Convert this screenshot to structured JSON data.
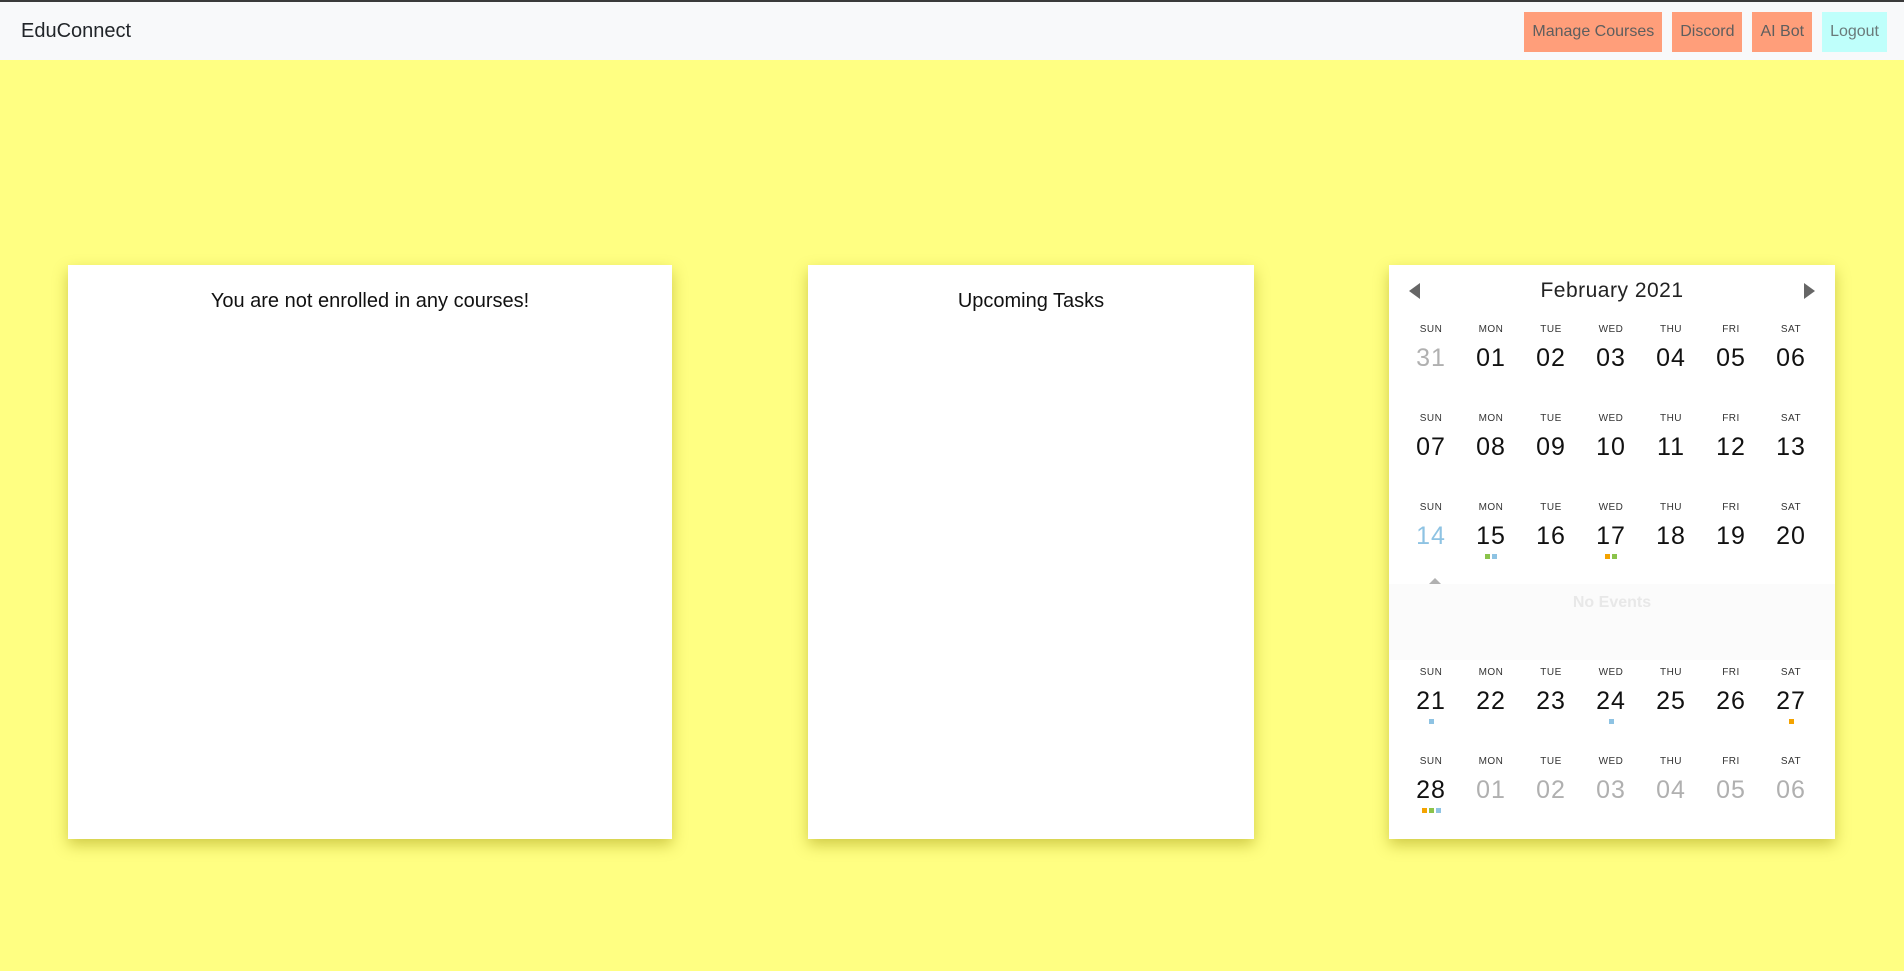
{
  "navbar": {
    "brand": "EduConnect",
    "buttons": [
      {
        "label": "Manage Courses"
      },
      {
        "label": "Discord"
      },
      {
        "label": "AI Bot"
      },
      {
        "label": "Logout"
      }
    ]
  },
  "courses": {
    "message": "You are not enrolled in any courses!"
  },
  "tasks": {
    "title": "Upcoming Tasks"
  },
  "calendar": {
    "month_label": "February 2021",
    "no_events": "No Events",
    "colors": {
      "orange": "#f4a300",
      "green": "#8bc34a",
      "blue": "#8ec3e3"
    },
    "day_names": [
      "SUN",
      "MON",
      "TUE",
      "WED",
      "THU",
      "FRI",
      "SAT"
    ],
    "weeks": [
      [
        {
          "n": "31",
          "other": true
        },
        {
          "n": "01"
        },
        {
          "n": "02"
        },
        {
          "n": "03"
        },
        {
          "n": "04"
        },
        {
          "n": "05"
        },
        {
          "n": "06"
        }
      ],
      [
        {
          "n": "07"
        },
        {
          "n": "08"
        },
        {
          "n": "09"
        },
        {
          "n": "10"
        },
        {
          "n": "11"
        },
        {
          "n": "12"
        },
        {
          "n": "13"
        }
      ],
      [
        {
          "n": "14",
          "today": true
        },
        {
          "n": "15",
          "dots": [
            "green",
            "blue"
          ]
        },
        {
          "n": "16"
        },
        {
          "n": "17",
          "dots": [
            "orange",
            "green"
          ]
        },
        {
          "n": "18"
        },
        {
          "n": "19"
        },
        {
          "n": "20"
        }
      ],
      [
        {
          "n": "21",
          "dots": [
            "blue"
          ]
        },
        {
          "n": "22"
        },
        {
          "n": "23"
        },
        {
          "n": "24",
          "dots": [
            "blue"
          ]
        },
        {
          "n": "25"
        },
        {
          "n": "26"
        },
        {
          "n": "27",
          "dots": [
            "orange"
          ]
        }
      ],
      [
        {
          "n": "28",
          "dots": [
            "orange",
            "green",
            "blue"
          ]
        },
        {
          "n": "01",
          "other": true
        },
        {
          "n": "02",
          "other": true
        },
        {
          "n": "03",
          "other": true
        },
        {
          "n": "04",
          "other": true
        },
        {
          "n": "05",
          "other": true
        },
        {
          "n": "06",
          "other": true
        }
      ]
    ]
  }
}
